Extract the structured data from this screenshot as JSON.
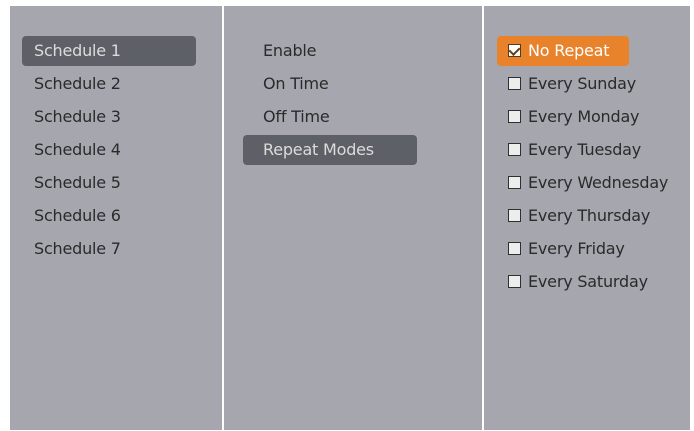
{
  "schedules": {
    "items": [
      {
        "label": "Schedule 1",
        "selected": true
      },
      {
        "label": "Schedule 2",
        "selected": false
      },
      {
        "label": "Schedule 3",
        "selected": false
      },
      {
        "label": "Schedule 4",
        "selected": false
      },
      {
        "label": "Schedule 5",
        "selected": false
      },
      {
        "label": "Schedule 6",
        "selected": false
      },
      {
        "label": "Schedule 7",
        "selected": false
      }
    ]
  },
  "settings": {
    "items": [
      {
        "label": "Enable",
        "selected": false
      },
      {
        "label": "On Time",
        "selected": false
      },
      {
        "label": "Off Time",
        "selected": false
      },
      {
        "label": "Repeat Modes",
        "selected": true
      }
    ]
  },
  "repeat_modes": {
    "options": [
      {
        "label": "No Repeat",
        "checked": true
      },
      {
        "label": "Every Sunday",
        "checked": false
      },
      {
        "label": "Every Monday",
        "checked": false
      },
      {
        "label": "Every Tuesday",
        "checked": false
      },
      {
        "label": "Every Wednesday",
        "checked": false
      },
      {
        "label": "Every Thursday",
        "checked": false
      },
      {
        "label": "Every Friday",
        "checked": false
      },
      {
        "label": "Every Saturday",
        "checked": false
      }
    ]
  },
  "colors": {
    "panel_background": "#a6a7ae",
    "selected_background": "#5e6067",
    "accent_orange": "#e8822b"
  }
}
